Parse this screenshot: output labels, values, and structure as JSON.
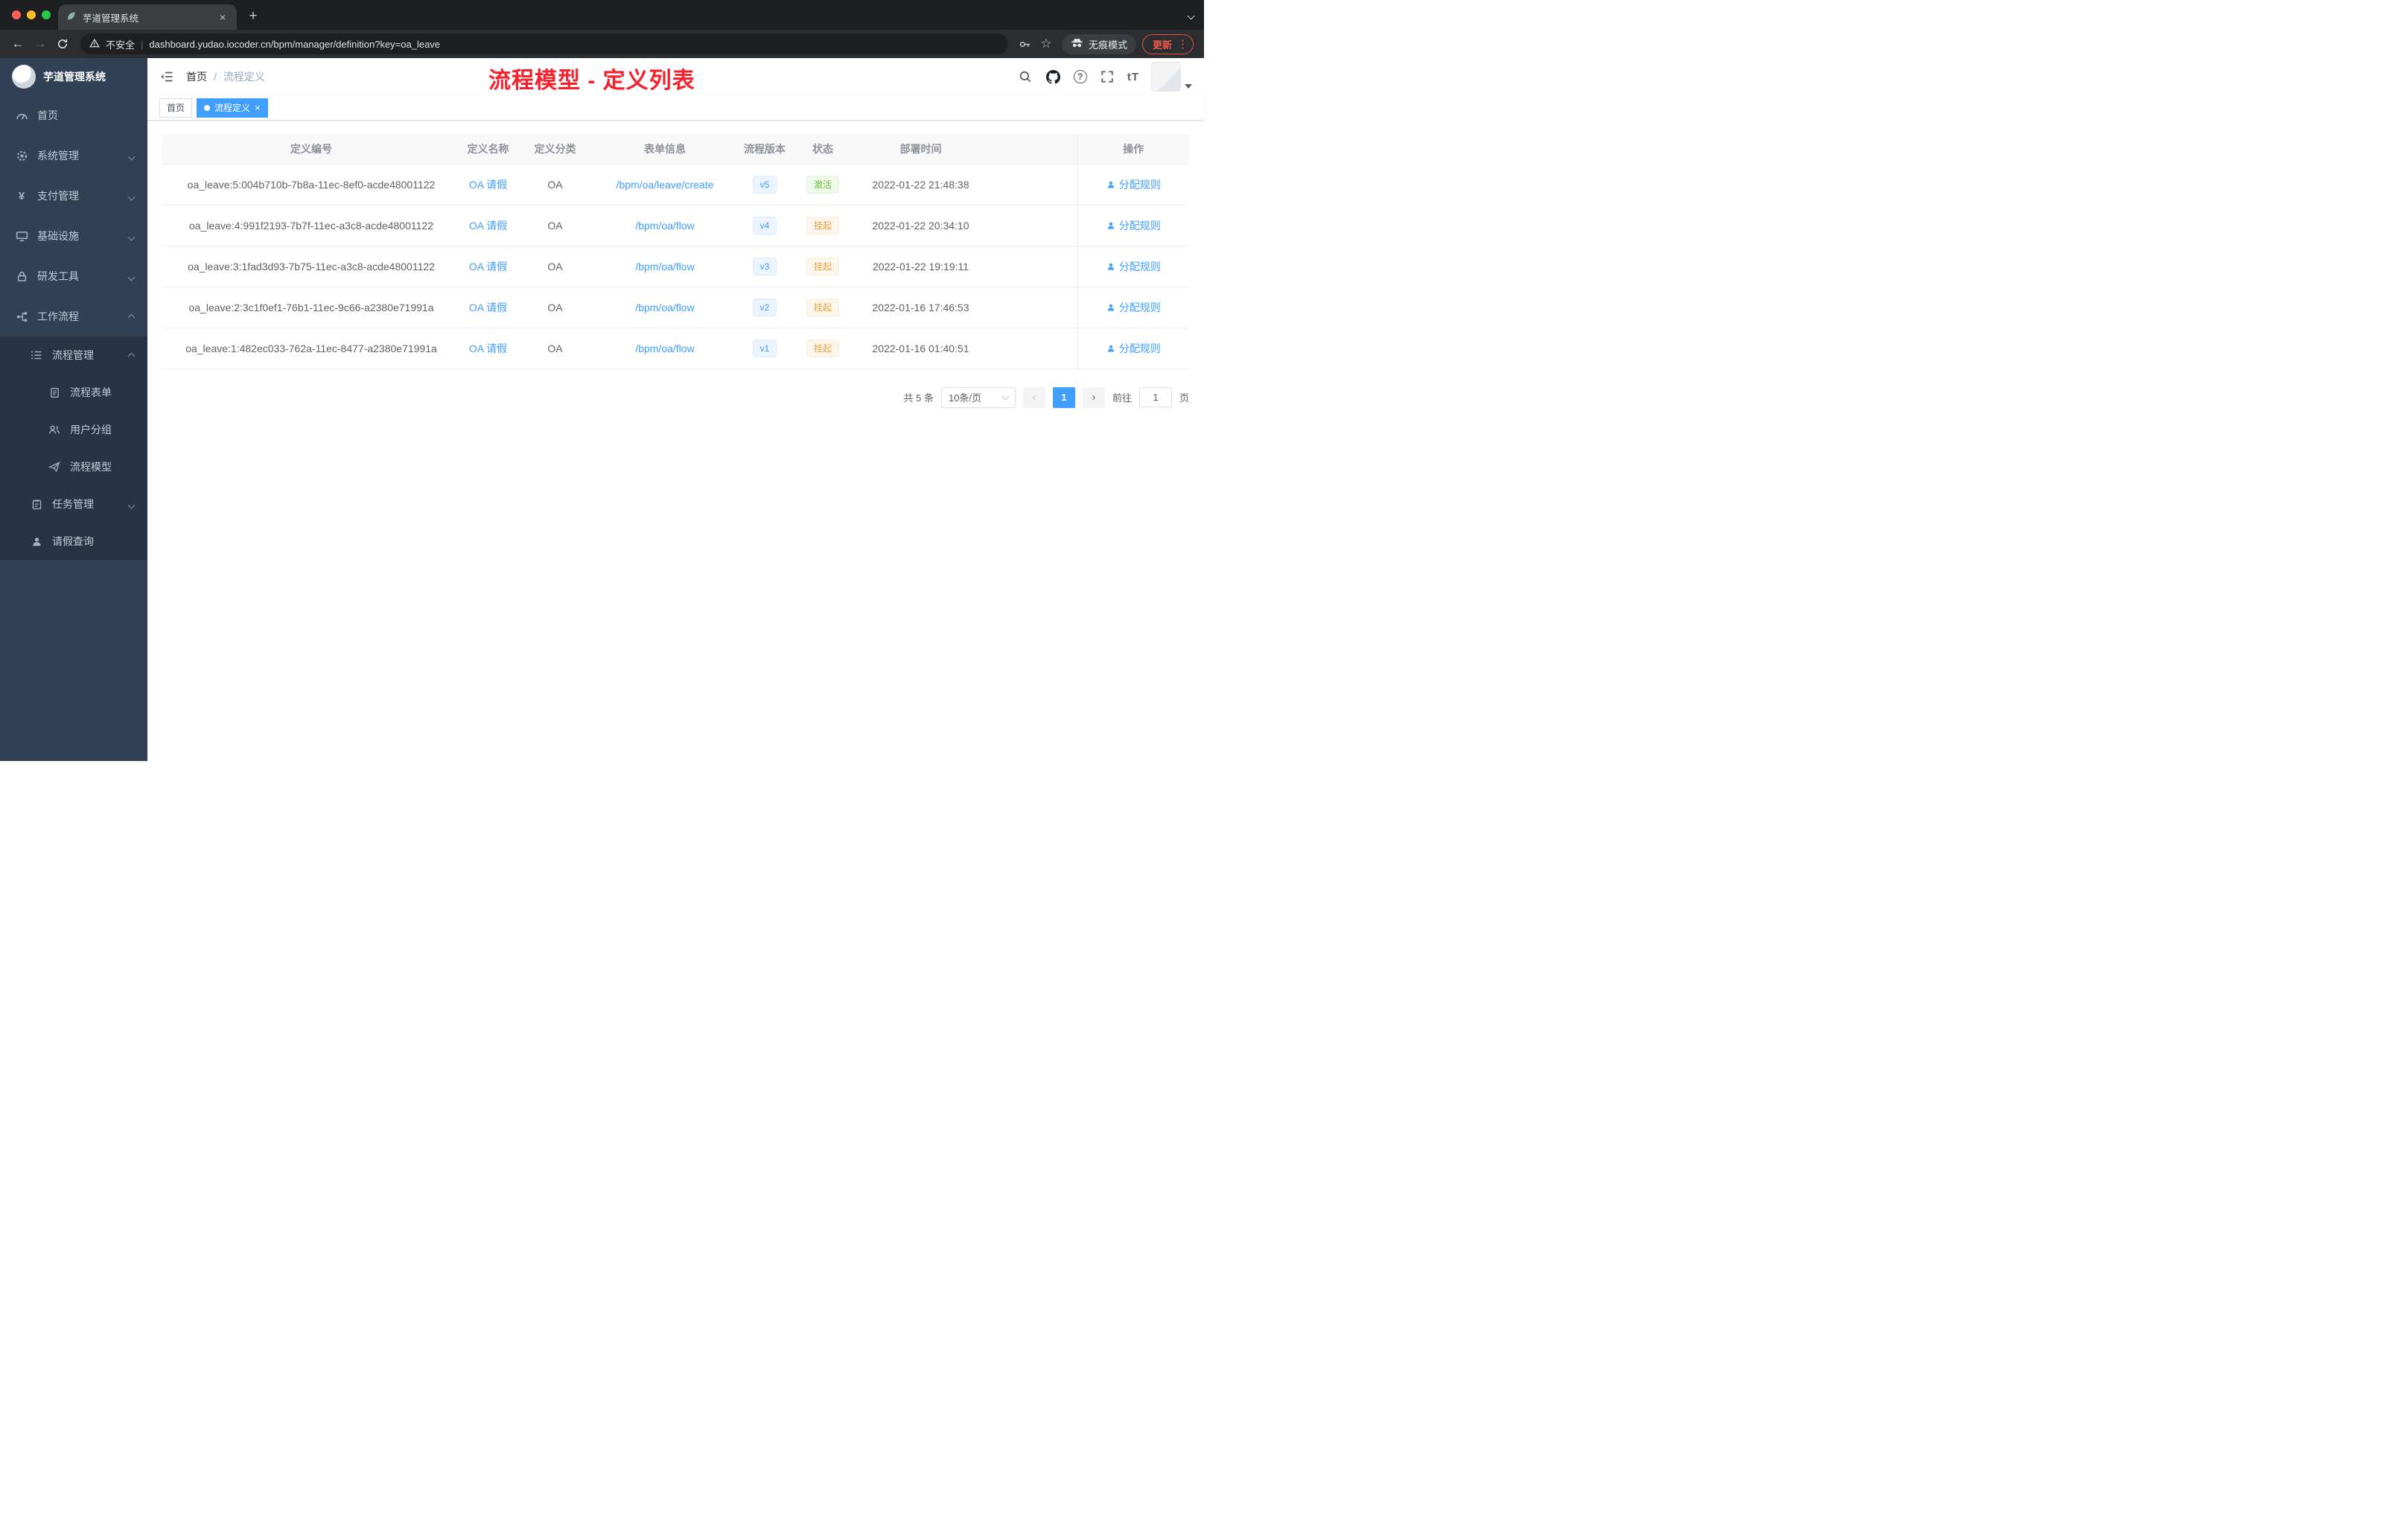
{
  "browser": {
    "tab_title": "芋道管理系统",
    "security_label": "不安全",
    "url": "dashboard.yudao.iocoder.cn/bpm/manager/definition?key=oa_leave",
    "incognito_label": "无痕模式",
    "update_label": "更新"
  },
  "icons": {
    "close": "×",
    "plus": "+",
    "kebab": "⋮",
    "star": "☆",
    "prev": "‹",
    "next": "›",
    "question": "?",
    "back": "←",
    "forward": "→"
  },
  "sidebar": {
    "logo_title": "芋道管理系统",
    "items": [
      {
        "label": "首页"
      },
      {
        "label": "系统管理"
      },
      {
        "label": "支付管理"
      },
      {
        "label": "基础设施"
      },
      {
        "label": "研发工具"
      },
      {
        "label": "工作流程"
      },
      {
        "label": "流程管理"
      },
      {
        "label": "流程表单"
      },
      {
        "label": "用户分组"
      },
      {
        "label": "流程模型"
      },
      {
        "label": "任务管理"
      },
      {
        "label": "请假查询"
      }
    ]
  },
  "header": {
    "breadcrumb": {
      "home": "首页",
      "separator": "/",
      "current": "流程定义"
    },
    "annotation": "流程模型 - 定义列表",
    "font_size_icon": "tT"
  },
  "tags": {
    "home": "首页",
    "active": "流程定义"
  },
  "table": {
    "columns": [
      "定义编号",
      "定义名称",
      "定义分类",
      "表单信息",
      "流程版本",
      "状态",
      "部署时间",
      "操作"
    ],
    "rows": [
      {
        "id": "oa_leave:5:004b710b-7b8a-11ec-8ef0-acde48001122",
        "name": "OA 请假",
        "category": "OA",
        "form": "/bpm/oa/leave/create",
        "version": "v5",
        "status": "激活",
        "time": "2022-01-22 21:48:38",
        "action": "分配规则"
      },
      {
        "id": "oa_leave:4:991f2193-7b7f-11ec-a3c8-acde48001122",
        "name": "OA 请假",
        "category": "OA",
        "form": "/bpm/oa/flow",
        "version": "v4",
        "status": "挂起",
        "time": "2022-01-22 20:34:10",
        "action": "分配规则"
      },
      {
        "id": "oa_leave:3:1fad3d93-7b75-11ec-a3c8-acde48001122",
        "name": "OA 请假",
        "category": "OA",
        "form": "/bpm/oa/flow",
        "version": "v3",
        "status": "挂起",
        "time": "2022-01-22 19:19:11",
        "action": "分配规则"
      },
      {
        "id": "oa_leave:2:3c1f0ef1-76b1-11ec-9c66-a2380e71991a",
        "name": "OA 请假",
        "category": "OA",
        "form": "/bpm/oa/flow",
        "version": "v2",
        "status": "挂起",
        "time": "2022-01-16 17:46:53",
        "action": "分配规则"
      },
      {
        "id": "oa_leave:1:482ec033-762a-11ec-8477-a2380e71991a",
        "name": "OA 请假",
        "category": "OA",
        "form": "/bpm/oa/flow",
        "version": "v1",
        "status": "挂起",
        "time": "2022-01-16 01:40:51",
        "action": "分配规则"
      }
    ]
  },
  "pagination": {
    "total": "共 5 条",
    "page_size": "10条/页",
    "current": "1",
    "goto_label": "前往",
    "goto_value": "1",
    "page_unit": "页"
  },
  "colors": {
    "primary": "#409eff",
    "success": "#67c23a",
    "warning": "#e6a23c",
    "annotation_red": "#f5222d",
    "sidebar_bg": "#304156",
    "submenu_bg": "#263445"
  }
}
